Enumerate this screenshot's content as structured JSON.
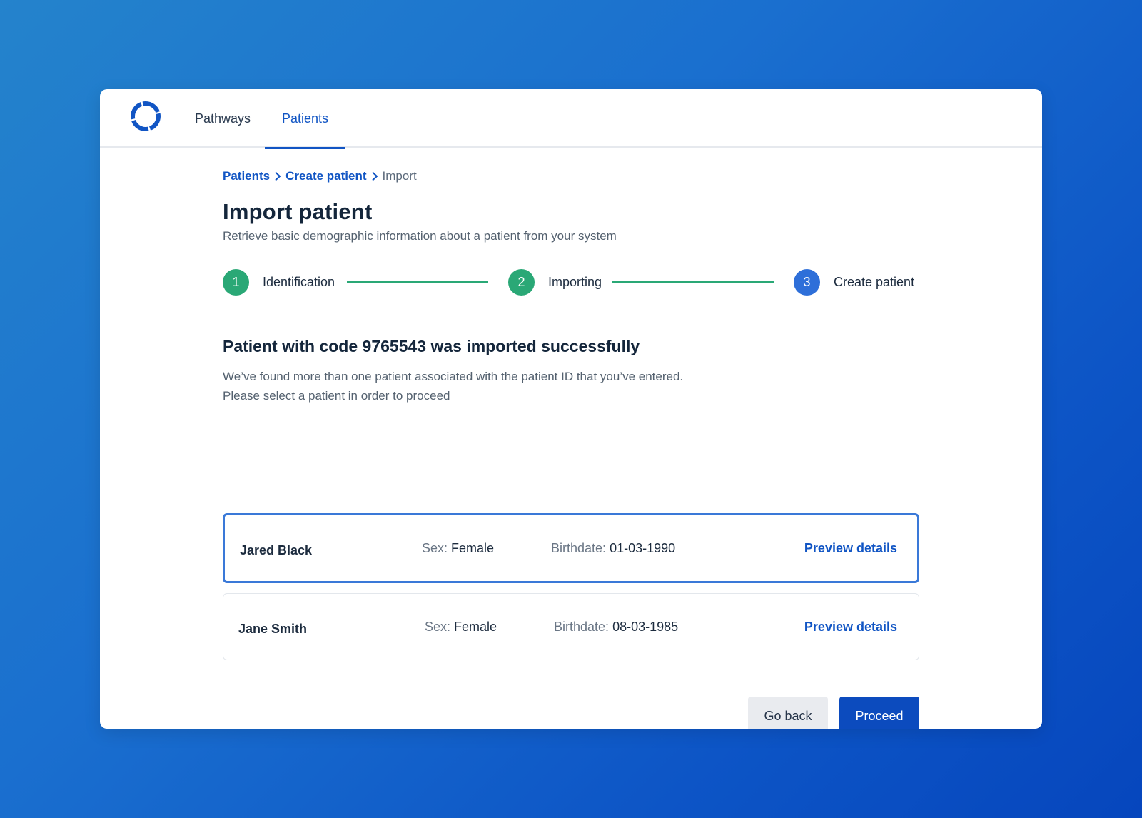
{
  "nav": {
    "tabs": [
      {
        "label": "Pathways",
        "active": false
      },
      {
        "label": "Patients",
        "active": true
      }
    ]
  },
  "breadcrumb": {
    "items": [
      {
        "label": "Patients",
        "link": true
      },
      {
        "label": "Create patient",
        "link": true
      },
      {
        "label": "Import",
        "link": false
      }
    ]
  },
  "page": {
    "title": "Import patient",
    "subtitle": "Retrieve basic demographic information about a patient from your system"
  },
  "stepper": {
    "steps": [
      {
        "number": "1",
        "label": "Identification",
        "state": "done"
      },
      {
        "number": "2",
        "label": "Importing",
        "state": "done"
      },
      {
        "number": "3",
        "label": "Create patient",
        "state": "active"
      }
    ]
  },
  "result": {
    "title": "Patient with code 9765543 was imported successfully",
    "message_line1": "We’ve found more than one patient associated with the patient ID that you’ve entered.",
    "message_line2": "Please select a patient in order to proceed"
  },
  "patients": [
    {
      "name": "Jared Black",
      "sex_label": "Sex:",
      "sex": "Female",
      "birth_label": "Birthdate:",
      "birthdate": "01-03-1990",
      "action": "Preview details",
      "selected": true
    },
    {
      "name": "Jane Smith",
      "sex_label": "Sex:",
      "sex": "Female",
      "birth_label": "Birthdate:",
      "birthdate": "08-03-1985",
      "action": "Preview details",
      "selected": false
    }
  ],
  "actions": {
    "back_label": "Go back",
    "proceed_label": "Proceed"
  },
  "colors": {
    "primary": "#1155c4",
    "success": "#2aa876",
    "step_active": "#2e6fd9",
    "selected_border": "#3a79d8"
  }
}
